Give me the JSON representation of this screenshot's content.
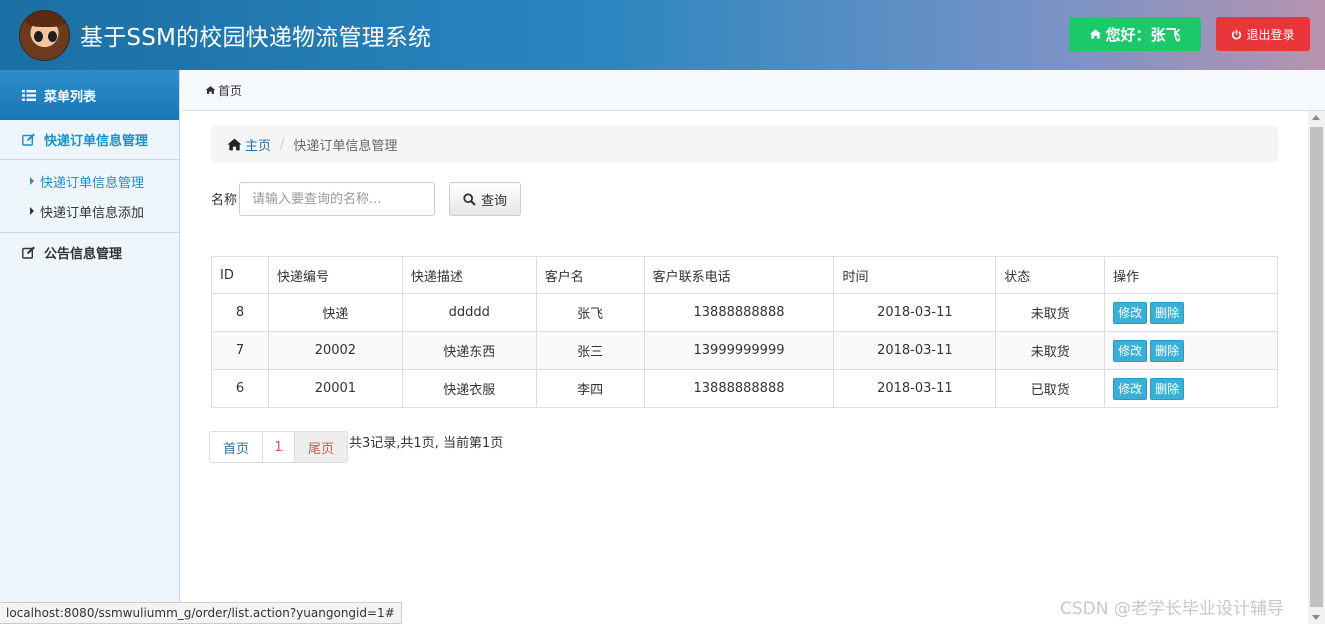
{
  "header": {
    "title": "基于SSM的校园快递物流管理系统",
    "greeting": "您好：张飞",
    "logout_label": "退出登录"
  },
  "sidebar": {
    "menu_title": "菜单列表",
    "groups": [
      {
        "label": "快递订单信息管理",
        "items": [
          {
            "label": "快递订单信息管理"
          },
          {
            "label": "快递订单信息添加"
          }
        ]
      },
      {
        "label": "公告信息管理"
      }
    ]
  },
  "topbar": {
    "label": "首页"
  },
  "breadcrumb": {
    "home": "主页",
    "current": "快递订单信息管理"
  },
  "search": {
    "label": "名称",
    "placeholder": "请输入要查询的名称...",
    "button": "查询"
  },
  "table": {
    "headers": [
      "ID",
      "快递编号",
      "快递描述",
      "客户名",
      "客户联系电话",
      "时间",
      "状态",
      "操作"
    ],
    "rows": [
      {
        "id": "8",
        "code": "快递",
        "desc": "ddddd",
        "customer": "张飞",
        "phone": "13888888888",
        "time": "2018-03-11",
        "status": "未取货"
      },
      {
        "id": "7",
        "code": "20002",
        "desc": "快递东西",
        "customer": "张三",
        "phone": "13999999999",
        "time": "2018-03-11",
        "status": "未取货"
      },
      {
        "id": "6",
        "code": "20001",
        "desc": "快递衣服",
        "customer": "李四",
        "phone": "13888888888",
        "time": "2018-03-11",
        "status": "已取货"
      }
    ],
    "edit_label": "修改",
    "delete_label": "删除"
  },
  "pagination": {
    "first": "首页",
    "current": "1",
    "last": "尾页",
    "info": "共3记录,共1页, 当前第1页"
  },
  "statusbar": {
    "url": "localhost:8080/ssmwuliumm_g/order/list.action?yuangongid=1#"
  },
  "watermark": "CSDN @老学长毕业设计辅导"
}
